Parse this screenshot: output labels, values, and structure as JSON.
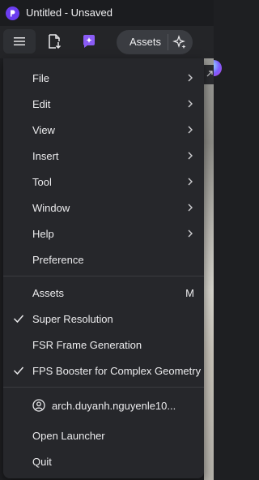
{
  "window": {
    "title": "Untitled - Unsaved"
  },
  "toolbar": {
    "assets_label": "Assets"
  },
  "menu": {
    "items": [
      {
        "label": "File",
        "submenu": true
      },
      {
        "label": "Edit",
        "submenu": true
      },
      {
        "label": "View",
        "submenu": true
      },
      {
        "label": "Insert",
        "submenu": true
      },
      {
        "label": "Tool",
        "submenu": true
      },
      {
        "label": "Window",
        "submenu": true
      },
      {
        "label": "Help",
        "submenu": true
      },
      {
        "label": "Preference",
        "submenu": false
      }
    ],
    "assets": {
      "label": "Assets",
      "shortcut": "M"
    },
    "super_resolution": {
      "label": "Super Resolution",
      "checked": true
    },
    "fsr_frame_generation": {
      "label": "FSR Frame Generation",
      "checked": false
    },
    "fps_booster": {
      "label": "FPS Booster for Complex Geometry",
      "checked": true
    },
    "account": {
      "label": "arch.duyanh.nguyenle10..."
    },
    "open_launcher": {
      "label": "Open Launcher"
    },
    "quit": {
      "label": "Quit"
    }
  },
  "colors": {
    "accent": "#6b3df0",
    "menu_bg": "#26272b",
    "text": "#ececee"
  }
}
